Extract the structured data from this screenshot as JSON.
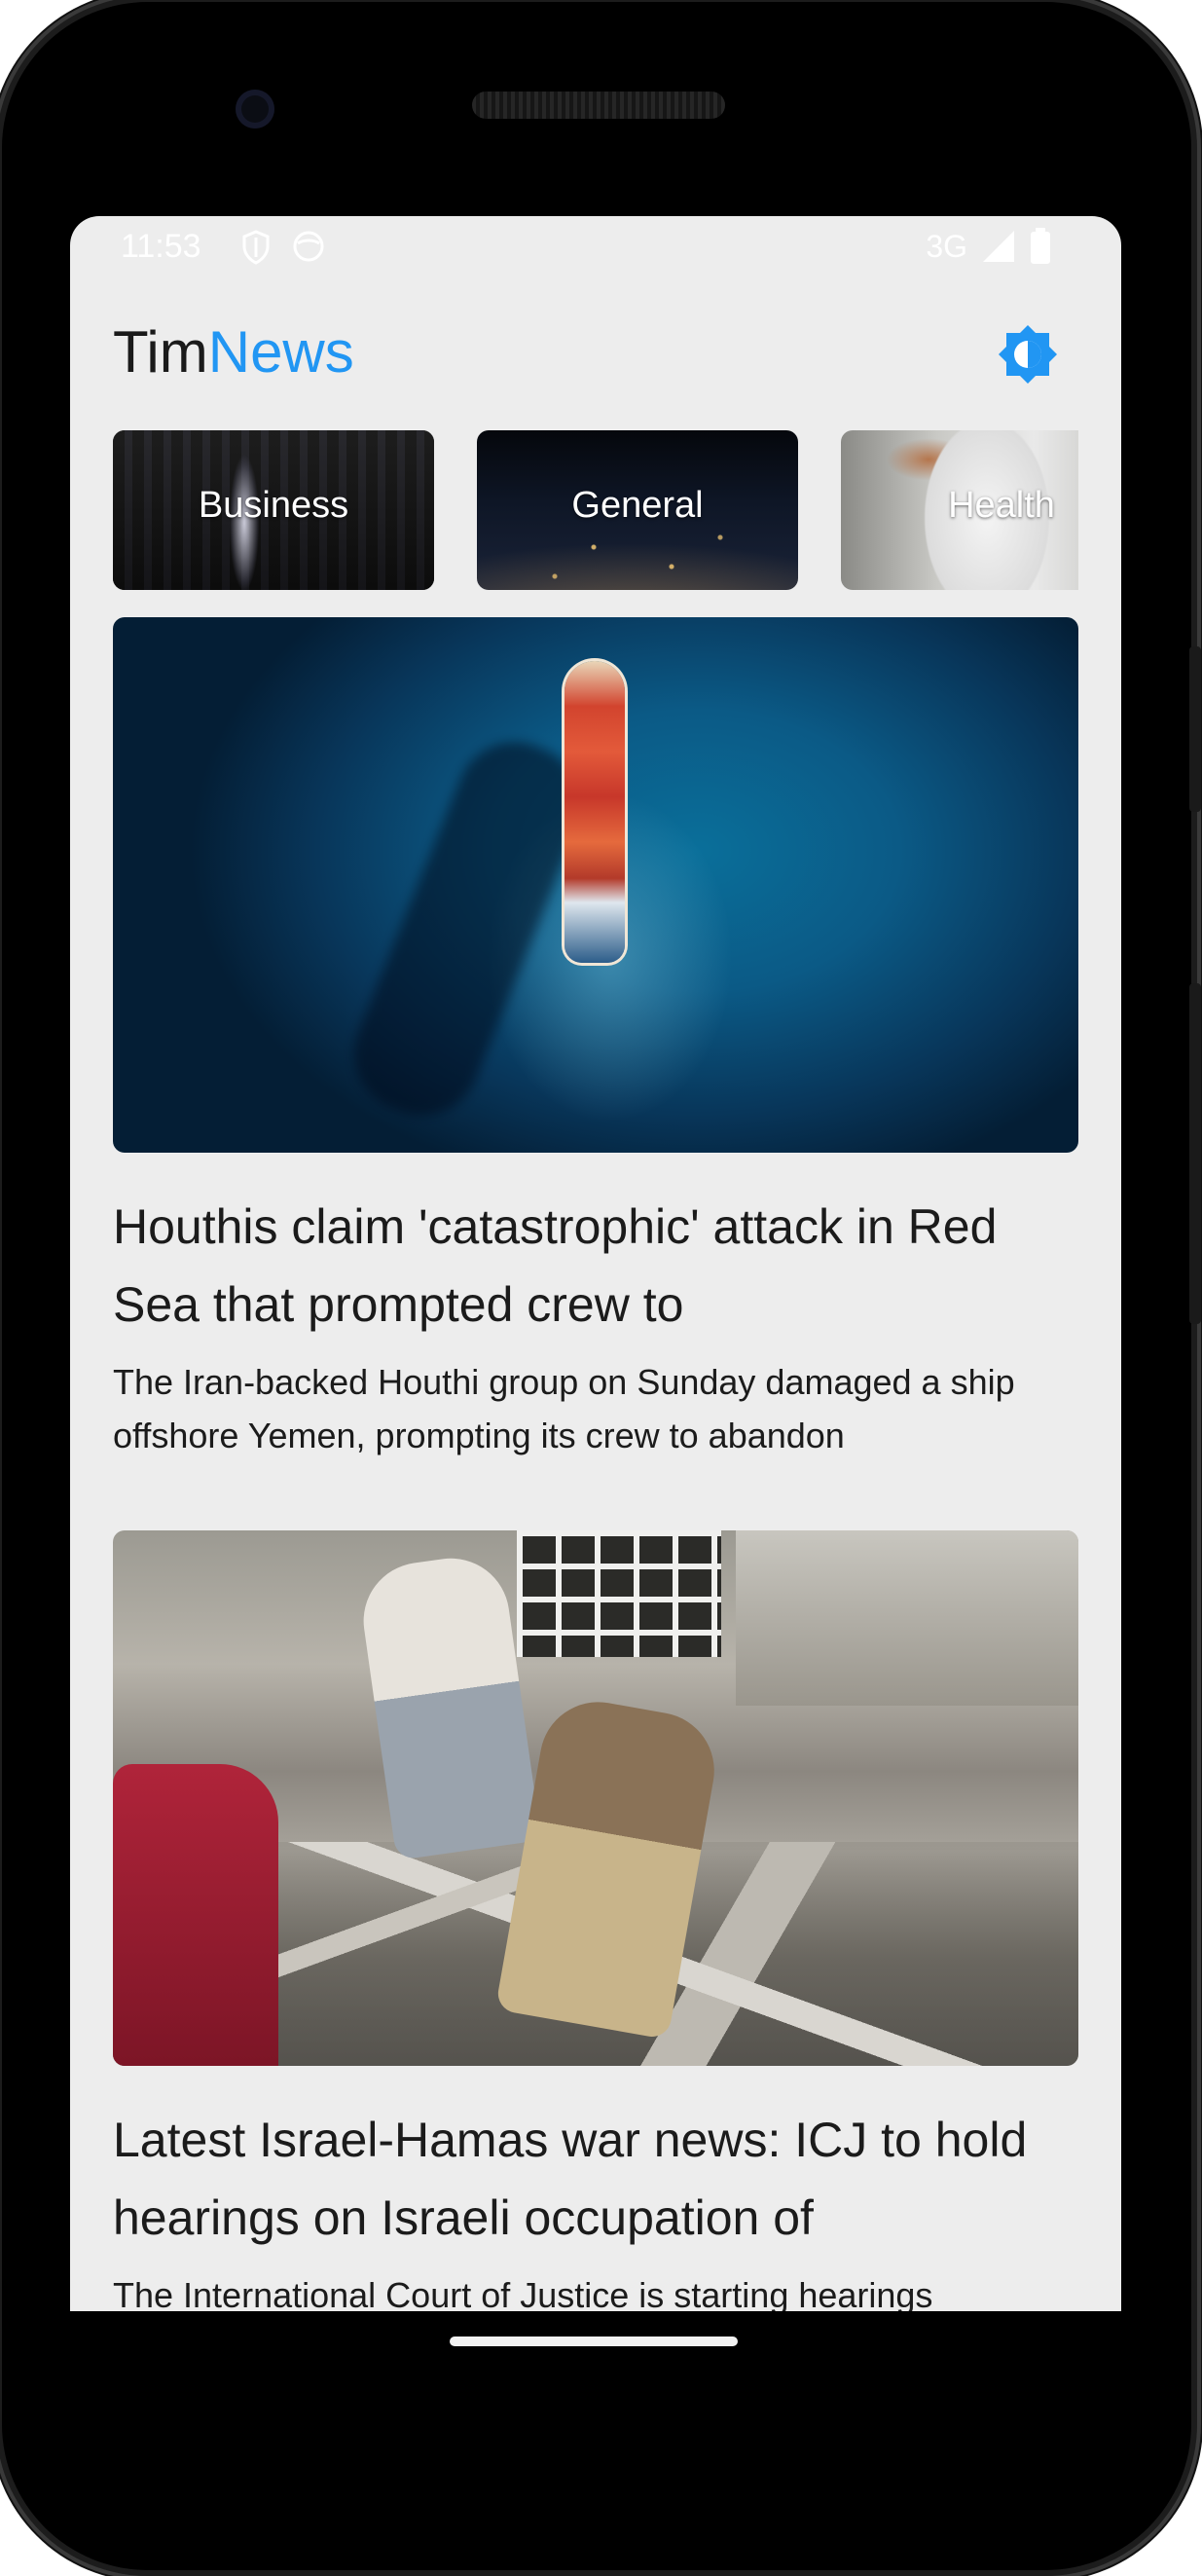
{
  "status_bar": {
    "time": "11:53",
    "network": "3G",
    "icons": [
      "shield-icon",
      "face-icon",
      "signal-icon",
      "battery-icon"
    ]
  },
  "app_bar": {
    "title_part1": "Tim",
    "title_part2": "News",
    "accent_color": "#2196f3",
    "theme_icon": "brightness-icon"
  },
  "categories": [
    {
      "label": "Business"
    },
    {
      "label": "General"
    },
    {
      "label": "Health"
    }
  ],
  "articles": [
    {
      "title": "Houthis claim 'catastrophic' attack in Red Sea that prompted crew to",
      "description": "The Iran-backed Houthi group on Sunday damaged a ship offshore Yemen, prompting its crew to abandon"
    },
    {
      "title": "Latest Israel-Hamas war news: ICJ to hold hearings on Israeli occupation of",
      "description": "The International Court of Justice is starting hearings"
    }
  ],
  "colors": {
    "screen_background": "#ededed",
    "text": "#1b1b1b"
  }
}
